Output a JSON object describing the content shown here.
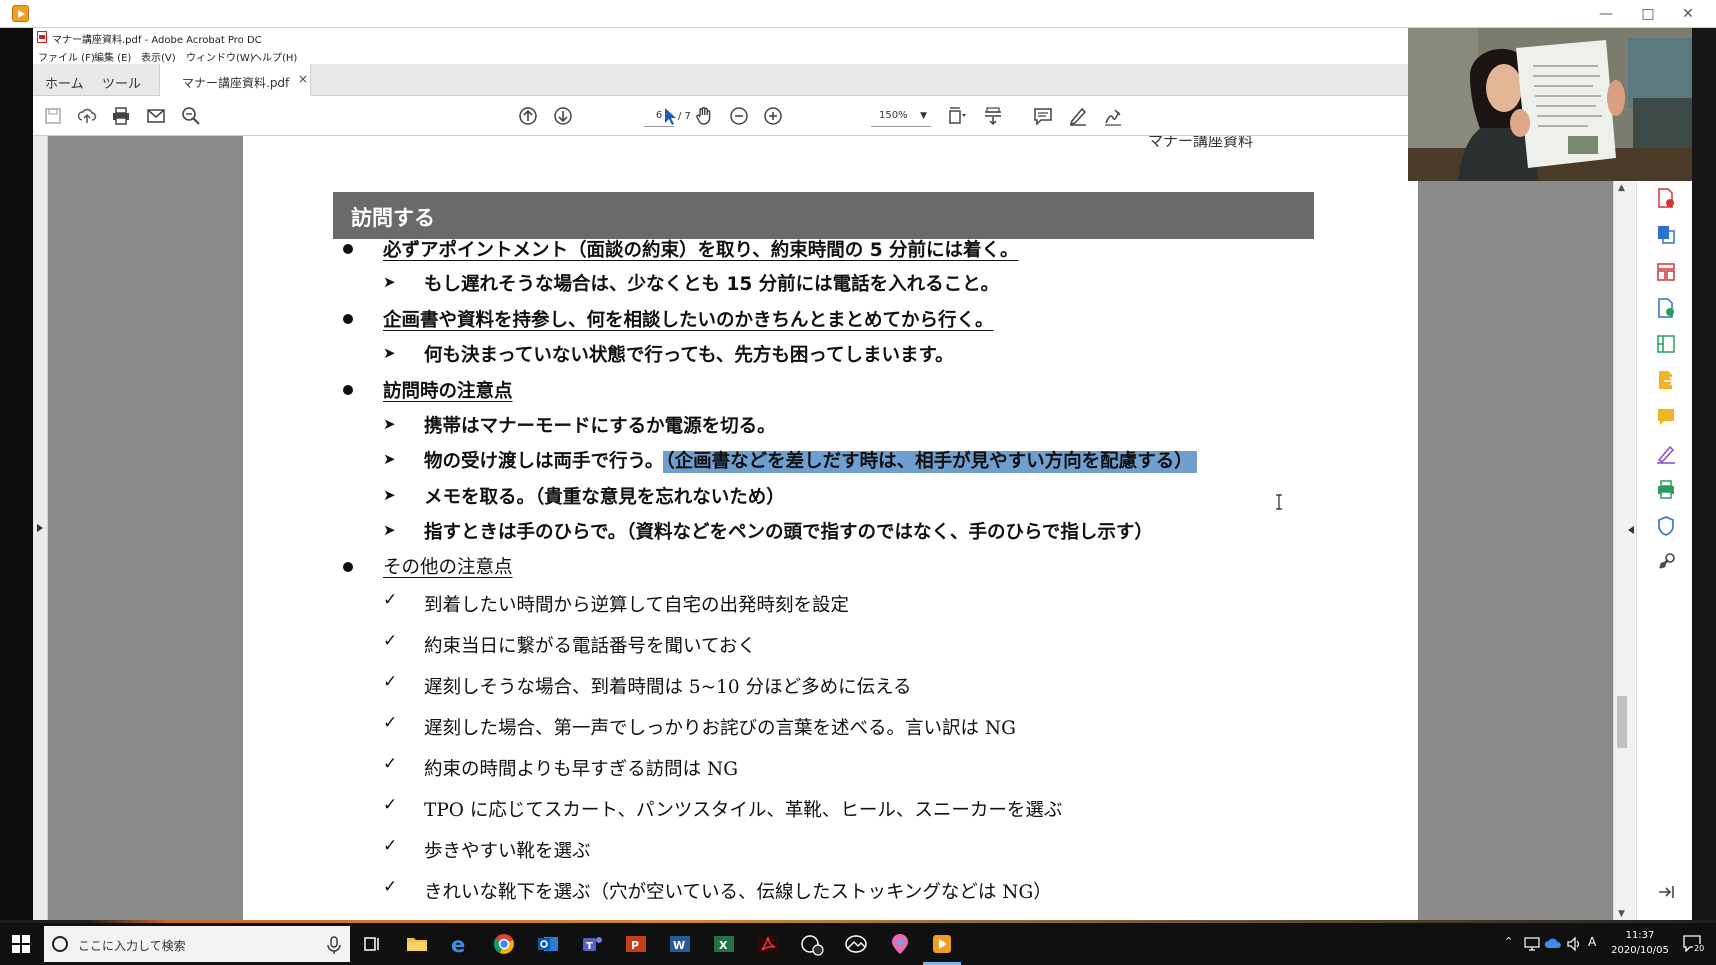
{
  "acrobat": {
    "window_title": "マナー講座資料.pdf - Adobe Acrobat Pro DC",
    "menu": [
      "ファイル (F)",
      "編集 (E)",
      "表示(V)",
      "ウィンドウ(W)",
      "ヘルプ(H)"
    ],
    "tabs": {
      "home": "ホーム",
      "tools": "ツール",
      "document": "マナー講座資料.pdf",
      "close_glyph": "×"
    },
    "toolbar": {
      "page_current": "6",
      "page_total": "/ 7",
      "zoom": "150%"
    }
  },
  "document": {
    "header_fragment": "マナー講座資料",
    "section_title": "訪問する",
    "lines": [
      {
        "kind": "bullet",
        "text": "必ずアポイントメント（面談の約束）を取り、約束時間の 5 分前には着く。"
      },
      {
        "kind": "arrow",
        "text": "もし遅れそうな場合は、少なくとも 15 分前には電話を入れること。"
      },
      {
        "kind": "bullet",
        "text": "企画書や資料を持参し、何を相談したいのかきちんとまとめてから行く。"
      },
      {
        "kind": "arrow",
        "text": "何も決まっていない状態で行っても、先方も困ってしまいます。"
      },
      {
        "kind": "bullet",
        "text": "訪問時の注意点"
      },
      {
        "kind": "arrow",
        "text": "携帯はマナーモードにするか電源を切る。"
      },
      {
        "kind": "arrow",
        "text": "物の受け渡しは両手で行う。",
        "highlight": "（企画書などを差しだす時は、相手が見やすい方向を配慮する）"
      },
      {
        "kind": "arrow",
        "text": "メモを取る。（貴重な意見を忘れないため）"
      },
      {
        "kind": "arrow",
        "text": "指すときは手のひらで。（資料などをペンの頭で指すのではなく、手のひらで指し示す）"
      },
      {
        "kind": "bullet",
        "text": "その他の注意点"
      },
      {
        "kind": "check",
        "text": "到着したい時間から逆算して自宅の出発時刻を設定"
      },
      {
        "kind": "check",
        "text": "約束当日に繋がる電話番号を聞いておく"
      },
      {
        "kind": "check",
        "text": "遅刻しそうな場合、到着時間は 5~10 分ほど多めに伝える"
      },
      {
        "kind": "check",
        "text": "遅刻した場合、第一声でしっかりお詫びの言葉を述べる。言い訳は NG"
      },
      {
        "kind": "check",
        "text": "約束の時間よりも早すぎる訪問は NG"
      },
      {
        "kind": "check",
        "text": "TPO に応じてスカート、パンツスタイル、革靴、ヒール、スニーカーを選ぶ"
      },
      {
        "kind": "check",
        "text": "歩きやすい靴を選ぶ"
      },
      {
        "kind": "check",
        "text": "きれいな靴下を選ぶ（穴が空いている、伝線したストッキングなどは NG）"
      }
    ]
  },
  "taskbar": {
    "search_placeholder": "ここに入力して検索",
    "clock_time": "11:37",
    "clock_date": "2020/10/05",
    "notification_count": "20",
    "ime_indicator": "A"
  },
  "colors": {
    "section_bar": "#6a6a6a",
    "highlight": "#6f9fcf",
    "page_gutter": "#8a8a8a",
    "taskbar": "#101010"
  }
}
